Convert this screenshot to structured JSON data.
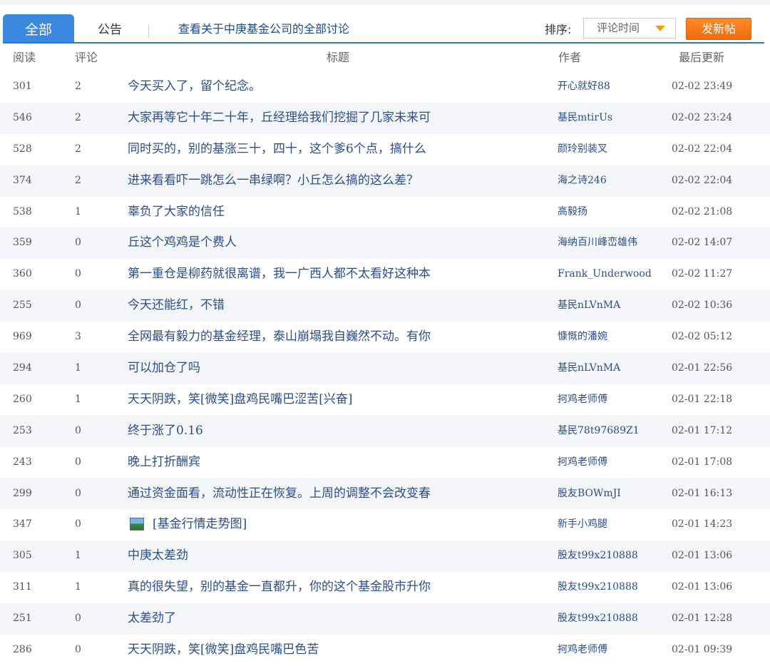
{
  "tabs": {
    "all": "全部",
    "notice": "公告",
    "view_all": "查看关于中庚基金公司的全部讨论"
  },
  "sort": {
    "label": "排序:",
    "value": "评论时间"
  },
  "new_post": "发新帖",
  "columns": {
    "read": "阅读",
    "comment": "评论",
    "title": "标题",
    "author": "作者",
    "updated": "最后更新"
  },
  "rows": [
    {
      "read": "301",
      "comment": "2",
      "title": "今天买入了，留个纪念。",
      "author": "开心就好88",
      "time": "02-02 23:49"
    },
    {
      "read": "546",
      "comment": "2",
      "title": "大家再等它十年二十年，丘经理给我们挖掘了几家未来可",
      "author": "基民mtirUs",
      "time": "02-02 23:24"
    },
    {
      "read": "528",
      "comment": "2",
      "title": "同时买的，别的基涨三十，四十，这个爹6个点，搞什么",
      "author": "颜玲别装叉",
      "time": "02-02 22:04"
    },
    {
      "read": "374",
      "comment": "2",
      "title": "进来看看吓一跳怎么一串绿啊？小丘怎么搞的这么差？",
      "author": "海之诗246",
      "time": "02-02 22:04"
    },
    {
      "read": "538",
      "comment": "1",
      "title": "辜负了大家的信任",
      "author": "高毅扬",
      "time": "02-02 21:08"
    },
    {
      "read": "359",
      "comment": "0",
      "title": "丘这个鸡鸡是个费人",
      "author": "海纳百川峰峦雄伟",
      "time": "02-02 14:07"
    },
    {
      "read": "360",
      "comment": "0",
      "title": "第一重仓是柳药就很离谱，我一广西人都不太看好这种本",
      "author": "Frank_Underwood",
      "time": "02-02 11:27"
    },
    {
      "read": "255",
      "comment": "0",
      "title": "今天还能红，不错",
      "author": "基民nLVnMA",
      "time": "02-02 10:36"
    },
    {
      "read": "969",
      "comment": "3",
      "title": "全网最有毅力的基金经理，泰山崩塌我自巍然不动。有你",
      "author": "慷慨的潘婉",
      "time": "02-02 05:12"
    },
    {
      "read": "294",
      "comment": "1",
      "title": "可以加仓了吗",
      "author": "基民nLVnMA",
      "time": "02-01 22:56"
    },
    {
      "read": "260",
      "comment": "1",
      "title": "天天阴跌，笑[微笑]盘鸡民嘴巴涩苦[兴奋]",
      "author": "抲鸡老师傅",
      "time": "02-01 22:18"
    },
    {
      "read": "253",
      "comment": "0",
      "title": "终于涨了0.16",
      "author": "基民78t97689Z1",
      "time": "02-01 17:12"
    },
    {
      "read": "243",
      "comment": "0",
      "title": "晚上打折酬宾",
      "author": "抲鸡老师傅",
      "time": "02-01 17:08"
    },
    {
      "read": "299",
      "comment": "0",
      "title": "通过资金面看，流动性正在恢复。上周的调整不会改变春",
      "author": "股友BOWmJI",
      "time": "02-01 16:13"
    },
    {
      "read": "347",
      "comment": "0",
      "title": "[基金行情走势图]",
      "author": "新手小鸡腿",
      "time": "02-01 14:23",
      "icon": "image-icon"
    },
    {
      "read": "305",
      "comment": "1",
      "title": "中庚太差劲",
      "author": "股友t99x210888",
      "time": "02-01 13:06"
    },
    {
      "read": "311",
      "comment": "1",
      "title": "真的很失望，别的基金一直都升，你的这个基金股市升你",
      "author": "股友t99x210888",
      "time": "02-01 13:06"
    },
    {
      "read": "251",
      "comment": "0",
      "title": "太差劲了",
      "author": "股友t99x210888",
      "time": "02-01 12:28"
    },
    {
      "read": "286",
      "comment": "0",
      "title": "天天阴跌，笑[微笑]盘鸡民嘴巴色苦",
      "author": "抲鸡老师傅",
      "time": "02-01 09:39"
    }
  ],
  "colors": {
    "tab_active_bg": "#3b88e0",
    "button_orange": "#f06a0a",
    "link_blue": "#2b4d8c",
    "row_alt_bg": "#f4f6f9"
  }
}
